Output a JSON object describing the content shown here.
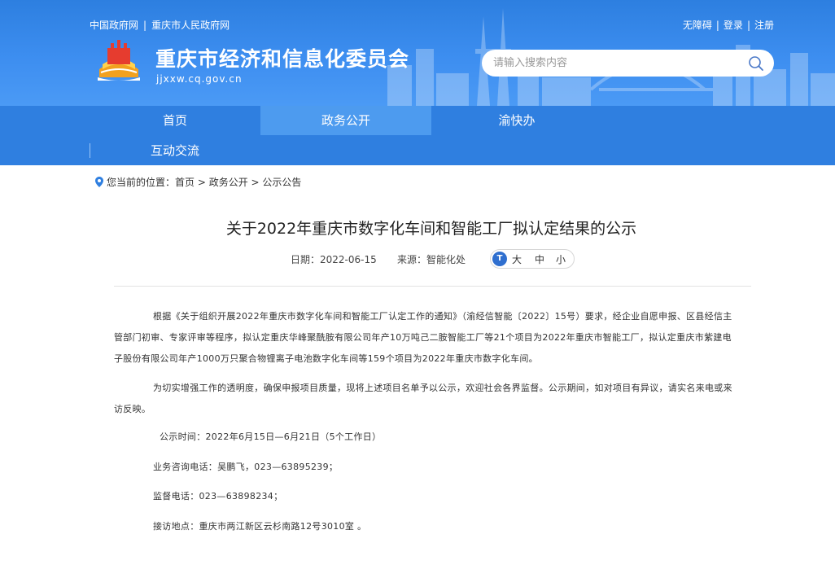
{
  "header": {
    "gov_link_1": "中国政府网",
    "gov_link_2": "重庆市人民政府网",
    "accessibility": "无障碍",
    "login": "登录",
    "register": "注册",
    "site_title": "重庆市经济和信息化委员会",
    "site_domain": "jjxxw.cq.gov.cn",
    "search_placeholder": "请输入搜索内容"
  },
  "nav": {
    "items": [
      {
        "label": "首页"
      },
      {
        "label": "政务公开"
      },
      {
        "label": "渝快办"
      },
      {
        "label": "互动交流"
      }
    ]
  },
  "breadcrumb": {
    "prefix": "您当前的位置：",
    "home": "首页",
    "level1": "政务公开",
    "level2": "公示公告",
    "arrow": " > "
  },
  "article": {
    "title": "关于2022年重庆市数字化车间和智能工厂拟认定结果的公示",
    "date_label": "日期：",
    "date": "2022-06-15",
    "source_label": "来源：",
    "source": "智能化处",
    "size_large": "大",
    "size_medium": "中",
    "size_small": "小",
    "paragraphs": [
      "根据《关于组织开展2022年重庆市数字化车间和智能工厂认定工作的通知》（渝经信智能〔2022〕15号）要求，经企业自愿申报、区县经信主管部门初审、专家评审等程序，拟认定重庆华峰聚酰胺有限公司年产10万吨己二胺智能工厂等21个项目为2022年重庆市智能工厂，拟认定重庆市紫建电子股份有限公司年产1000万只聚合物锂离子电池数字化车间等159个项目为2022年重庆市数字化车间。",
      "为切实增强工作的透明度，确保申报项目质量，现将上述项目名单予以公示，欢迎社会各界监督。公示期间，如对项目有异议，请实名来电或来访反映。",
      "公示时间：2022年6月15日—6月21日（5个工作日）",
      "业务咨询电话：吴鹏飞，023—63895239；",
      "监督电话：023—63898234；",
      "接访地点：重庆市两江新区云杉南路12号3010室 。"
    ]
  },
  "colors": {
    "header_blue": "#3d8ef0",
    "nav_blue": "#2f7fe0",
    "nav_active": "#4d9bef"
  }
}
